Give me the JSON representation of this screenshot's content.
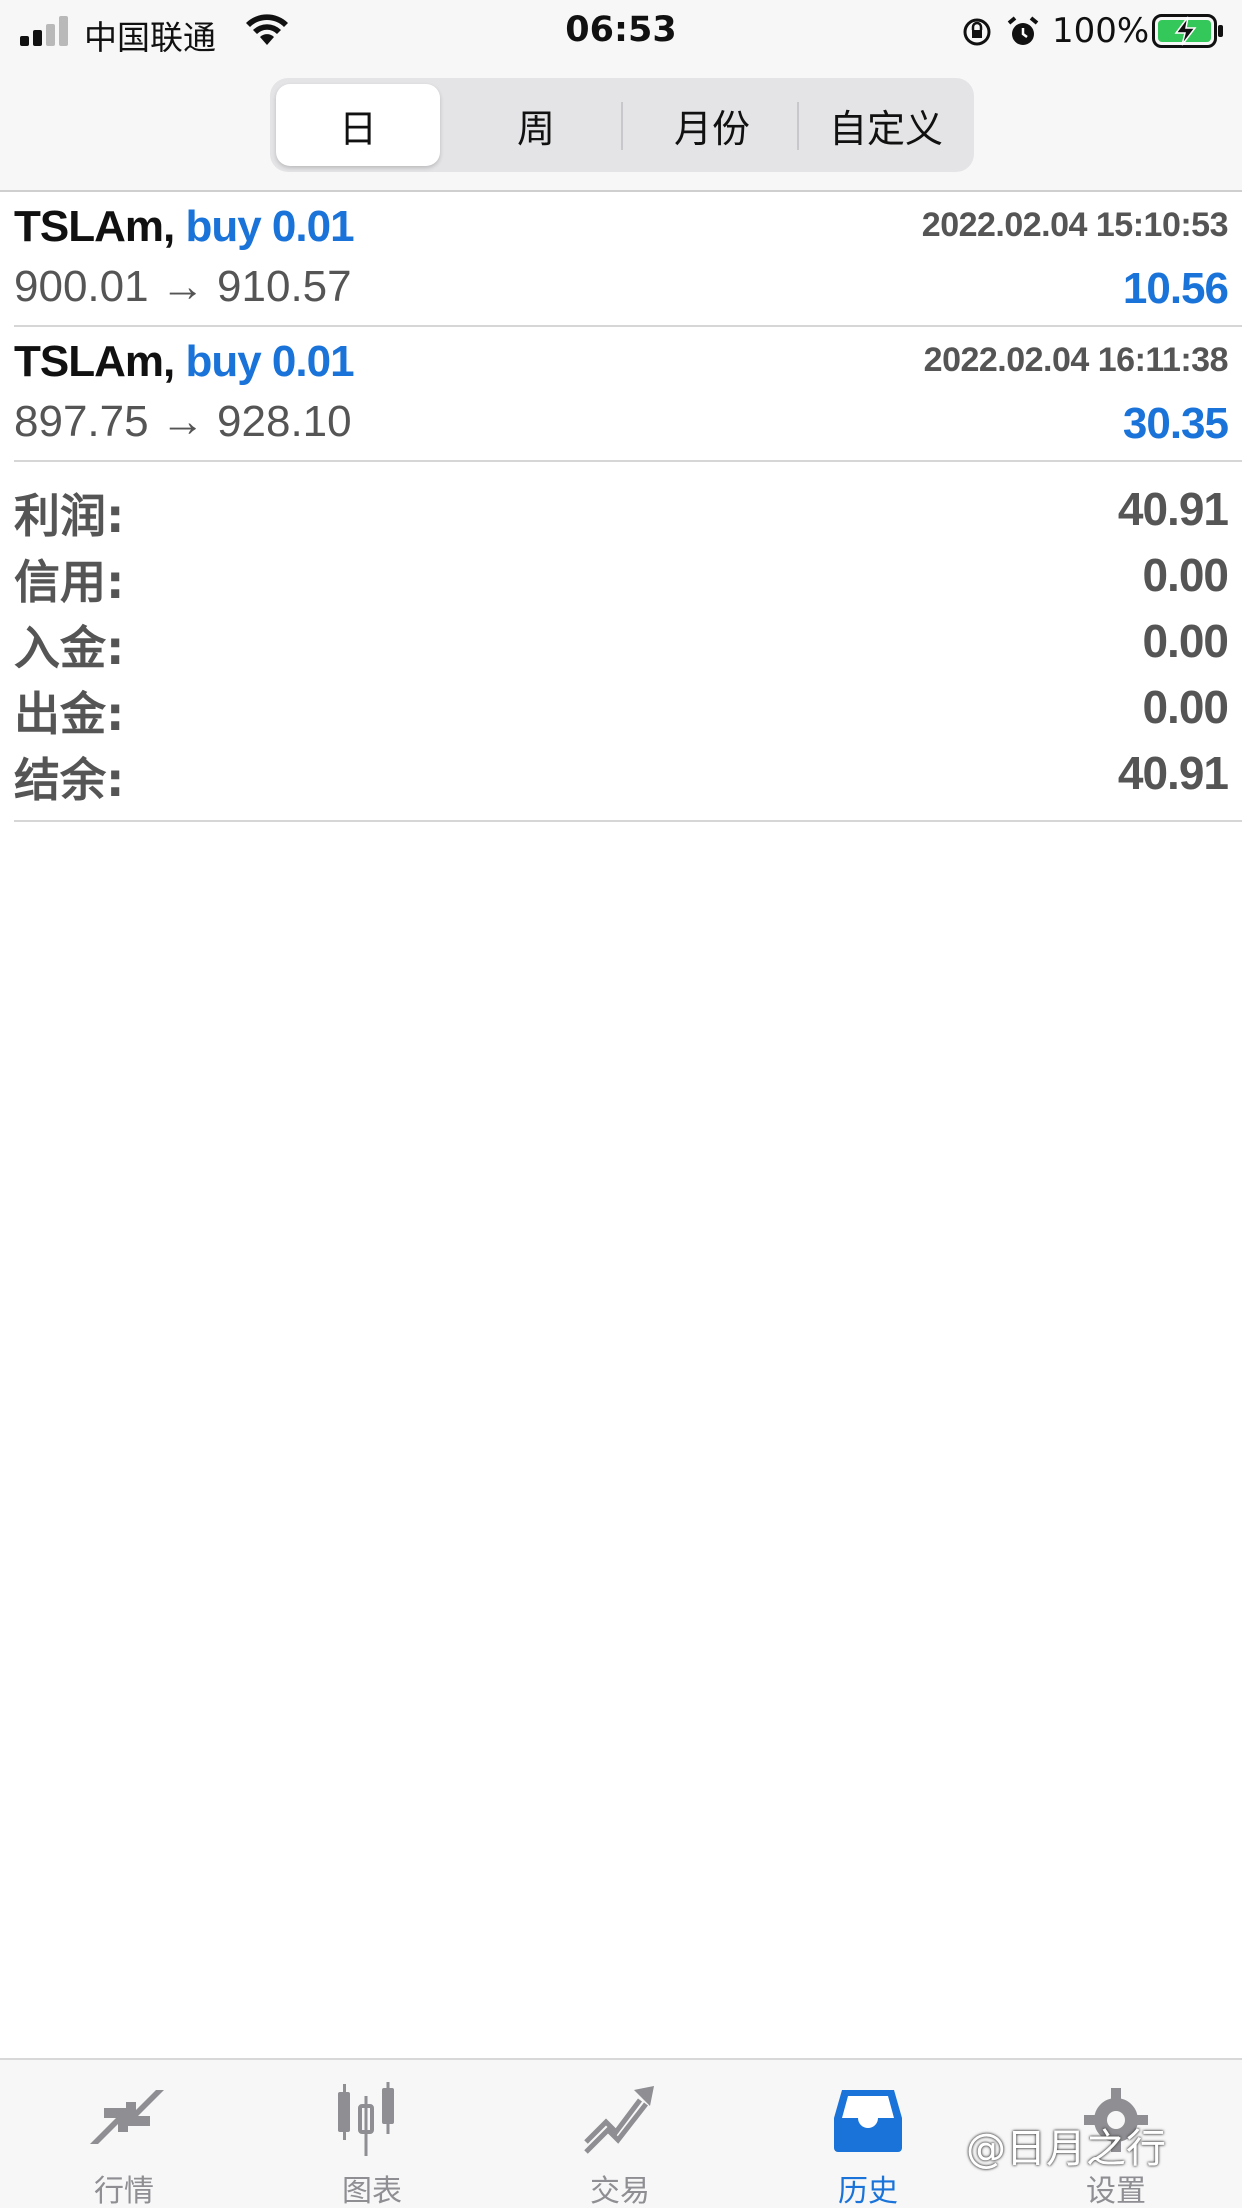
{
  "status_bar": {
    "carrier": "中国联通",
    "time": "06:53",
    "battery_percent": "100%",
    "icons": [
      "signal-icon",
      "wifi-icon",
      "orientation-lock-icon",
      "alarm-icon",
      "battery-charging-icon"
    ]
  },
  "period_tabs": [
    {
      "label": "日",
      "active": true
    },
    {
      "label": "周",
      "active": false
    },
    {
      "label": "月份",
      "active": false
    },
    {
      "label": "自定义",
      "active": false
    }
  ],
  "trades": [
    {
      "symbol": "TSLAm,",
      "side": "buy 0.01",
      "time": "2022.02.04 15:10:53",
      "prices": "900.01 → 910.57",
      "profit": "10.56"
    },
    {
      "symbol": "TSLAm,",
      "side": "buy 0.01",
      "time": "2022.02.04 16:11:38",
      "prices": "897.75 → 928.10",
      "profit": "30.35"
    }
  ],
  "summary": [
    {
      "label": "利润:",
      "value": "40.91"
    },
    {
      "label": "信用:",
      "value": "0.00"
    },
    {
      "label": "入金:",
      "value": "0.00"
    },
    {
      "label": "出金:",
      "value": "0.00"
    },
    {
      "label": "结余:",
      "value": "40.91"
    }
  ],
  "tab_bar": [
    {
      "label": "行情",
      "icon": "quotes-icon",
      "active": false
    },
    {
      "label": "图表",
      "icon": "chart-icon",
      "active": false
    },
    {
      "label": "交易",
      "icon": "trade-icon",
      "active": false
    },
    {
      "label": "历史",
      "icon": "history-icon",
      "active": true
    },
    {
      "label": "设置",
      "icon": "settings-icon",
      "active": false
    }
  ],
  "watermark": "@日月之行",
  "colors": {
    "accent": "#1a73d9",
    "muted": "#555555",
    "tab_inactive": "#8e8e93"
  }
}
